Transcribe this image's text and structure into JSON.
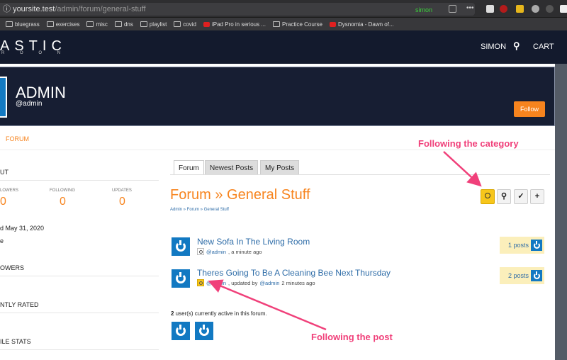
{
  "browser": {
    "url_host": "yoursite.test",
    "url_path": "/admin/forum/general-stuff",
    "profile": "simon",
    "bookmarks": [
      {
        "label": "bluegrass",
        "icon": "folder-icon"
      },
      {
        "label": "exercises",
        "icon": "folder-icon"
      },
      {
        "label": "misc",
        "icon": "folder-icon"
      },
      {
        "label": "dns",
        "icon": "folder-icon"
      },
      {
        "label": "playlist",
        "icon": "folder-icon"
      },
      {
        "label": "covid",
        "icon": "folder-icon"
      },
      {
        "label": "iPad Pro in serious ...",
        "icon": "youtube-icon"
      },
      {
        "label": "Practice Course",
        "icon": "folder-icon"
      },
      {
        "label": "Dysnomia - Dawn of...",
        "icon": "youtube-icon"
      }
    ]
  },
  "nav": {
    "logo": "ASTIC",
    "logo_sub": "R O O N",
    "user": "SIMON",
    "cart": "CART"
  },
  "profile": {
    "name": "ADMIN",
    "handle": "@admin",
    "follow": "Follow"
  },
  "subnav": {
    "forum": "FORUM"
  },
  "sidebar": {
    "about": "UT",
    "stats": [
      {
        "label": "LOWERS",
        "value": "0"
      },
      {
        "label": "FOLLOWING",
        "value": "0"
      },
      {
        "label": "UPDATES",
        "value": "0"
      }
    ],
    "joined": "d May 31, 2020",
    "extra": "e",
    "followers": "OWERS",
    "rated": "NTLY RATED",
    "file_stats": "ILE STATS"
  },
  "tabs": [
    "Forum",
    "Newest Posts",
    "My Posts"
  ],
  "forum": {
    "title": "Forum » General Stuff",
    "breadcrumb": "Admin » Forum » General Stuff",
    "topics": [
      {
        "title": "New Sofa In The Living Room",
        "author": "@admin",
        "meta": ", a minute ago",
        "updated_by": "",
        "time": "",
        "posts": "1 posts",
        "following": false
      },
      {
        "title": "Theres Going To Be A Cleaning Bee Next Thursday",
        "author": "@admin",
        "meta": ", updated by ",
        "updated_by": "@admin",
        "time": " 2 minutes ago",
        "posts": "2 posts",
        "following": true
      }
    ],
    "active_count": "2",
    "active_text": " user(s) currently active in this forum."
  },
  "annotations": {
    "category": "Following the category",
    "post": "Following the post",
    "color": "#f0407a"
  }
}
